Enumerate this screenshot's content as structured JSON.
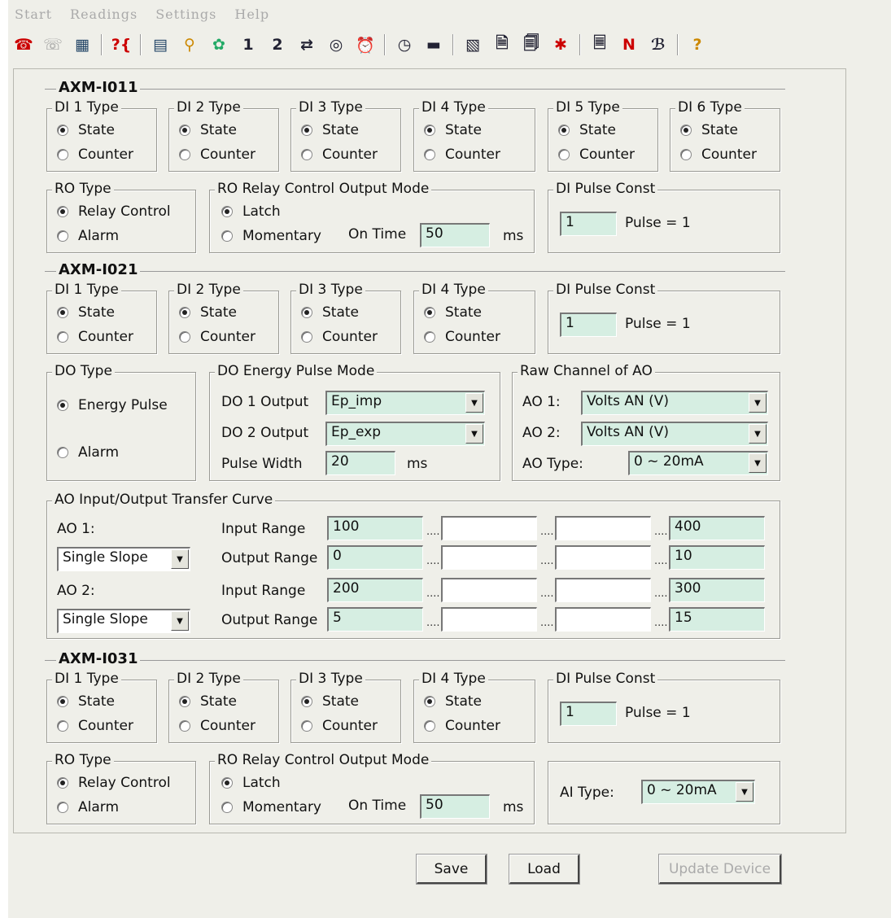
{
  "menu": [
    "Start",
    "Readings",
    "Settings",
    "Help"
  ],
  "toolbar": {
    "icons": [
      "phone-icon",
      "disconnect-icon",
      "device-list-icon",
      "query-icon",
      "display-icon",
      "setup-icon",
      "wizard-icon",
      "one",
      "two",
      "transfer-icon",
      "target-icon",
      "alarm-clock-icon",
      "timer-icon",
      "keyboard-icon",
      "report-icon",
      "e1-icon",
      "e2-icon",
      "harmonics-icon",
      "en-icon",
      "n-icon",
      "phase-icon",
      "help-icon"
    ],
    "one_label": "1",
    "two_label": "2",
    "n_label": "N",
    "help_label": "?"
  },
  "axm011": {
    "title": "AXM-I011",
    "di": [
      {
        "title": "DI 1 Type",
        "state": "State",
        "counter": "Counter"
      },
      {
        "title": "DI 2 Type",
        "state": "State",
        "counter": "Counter"
      },
      {
        "title": "DI 3 Type",
        "state": "State",
        "counter": "Counter"
      },
      {
        "title": "DI 4 Type",
        "state": "State",
        "counter": "Counter"
      },
      {
        "title": "DI 5 Type",
        "state": "State",
        "counter": "Counter"
      },
      {
        "title": "DI 6 Type",
        "state": "State",
        "counter": "Counter"
      }
    ],
    "ro_type": {
      "title": "RO Type",
      "relay": "Relay Control",
      "alarm": "Alarm"
    },
    "ro_mode": {
      "title": "RO Relay Control Output Mode",
      "latch": "Latch",
      "momentary": "Momentary",
      "on_time_label": "On Time",
      "on_time": "50",
      "unit": "ms"
    },
    "pulse": {
      "title": "DI Pulse Const",
      "value": "1",
      "label": "Pulse = 1"
    }
  },
  "axm021": {
    "title": "AXM-I021",
    "di": [
      {
        "title": "DI 1 Type",
        "state": "State",
        "counter": "Counter"
      },
      {
        "title": "DI 2 Type",
        "state": "State",
        "counter": "Counter"
      },
      {
        "title": "DI 3 Type",
        "state": "State",
        "counter": "Counter"
      },
      {
        "title": "DI 4 Type",
        "state": "State",
        "counter": "Counter"
      }
    ],
    "pulse": {
      "title": "DI Pulse Const",
      "value": "1",
      "label": "Pulse = 1"
    },
    "do_type": {
      "title": "DO Type",
      "energy": "Energy Pulse",
      "alarm": "Alarm"
    },
    "do_mode": {
      "title": "DO Energy Pulse Mode",
      "do1_label": "DO 1 Output",
      "do1": "Ep_imp",
      "do2_label": "DO 2 Output",
      "do2": "Ep_exp",
      "pw_label": "Pulse Width",
      "pw": "20",
      "unit": "ms"
    },
    "raw": {
      "title": "Raw Channel of AO",
      "ao1_label": "AO 1:",
      "ao1": "Volts AN (V)",
      "ao2_label": "AO 2:",
      "ao2": "Volts AN (V)",
      "type_label": "AO Type:",
      "type": "0 ~ 20mA"
    },
    "curve": {
      "title": "AO Input/Output Transfer Curve",
      "ao1_label": "AO 1:",
      "ao1_mode": "Single Slope",
      "ao2_label": "AO 2:",
      "ao2_mode": "Single Slope",
      "input_label": "Input Range",
      "output_label": "Output Range",
      "ao1_in": [
        "100",
        "",
        "",
        "400"
      ],
      "ao1_out": [
        "0",
        "",
        "",
        "10"
      ],
      "ao2_in": [
        "200",
        "",
        "",
        "300"
      ],
      "ao2_out": [
        "5",
        "",
        "",
        "15"
      ],
      "dots": "...."
    }
  },
  "axm031": {
    "title": "AXM-I031",
    "di": [
      {
        "title": "DI 1 Type",
        "state": "State",
        "counter": "Counter"
      },
      {
        "title": "DI 2 Type",
        "state": "State",
        "counter": "Counter"
      },
      {
        "title": "DI 3 Type",
        "state": "State",
        "counter": "Counter"
      },
      {
        "title": "DI 4 Type",
        "state": "State",
        "counter": "Counter"
      }
    ],
    "pulse": {
      "title": "DI Pulse Const",
      "value": "1",
      "label": "Pulse = 1"
    },
    "ro_type": {
      "title": "RO Type",
      "relay": "Relay Control",
      "alarm": "Alarm"
    },
    "ro_mode": {
      "title": "RO Relay Control Output Mode",
      "latch": "Latch",
      "momentary": "Momentary",
      "on_time_label": "On Time",
      "on_time": "50",
      "unit": "ms"
    },
    "ai_label": "AI Type:",
    "ai": "0 ~ 20mA"
  },
  "buttons": {
    "save": "Save",
    "load": "Load",
    "update": "Update Device"
  }
}
